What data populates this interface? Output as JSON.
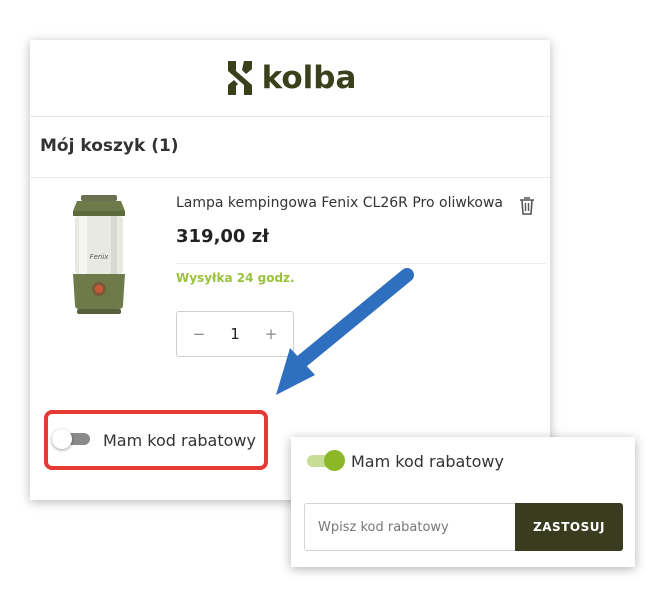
{
  "brand": {
    "name": "kolba",
    "color": "#3a3f1c"
  },
  "cart": {
    "title": "Mój koszyk (1)",
    "item": {
      "name": "Lampa kempingowa Fenix CL26R Pro oliwkowa",
      "price": "319,00 zł",
      "shipping": "Wysyłka 24 godz.",
      "quantity": "1",
      "image_label": "Fenix"
    },
    "qty_minus": "−",
    "qty_plus": "+"
  },
  "coupon": {
    "toggle_label": "Mam kod rabatowy",
    "toggle_state_main": "off",
    "toggle_state_popup": "on",
    "input_placeholder": "Wpisz kod rabatowy",
    "apply_label": "ZASTOSUJ"
  },
  "colors": {
    "accent_green": "#8cb828",
    "shipping_green": "#9ac23c",
    "button_dark": "#3a3c1f",
    "highlight_red": "#e53935",
    "arrow_blue": "#2f6fbf"
  },
  "icons": [
    "logo-mark-icon",
    "trash-icon",
    "arrow-icon"
  ]
}
